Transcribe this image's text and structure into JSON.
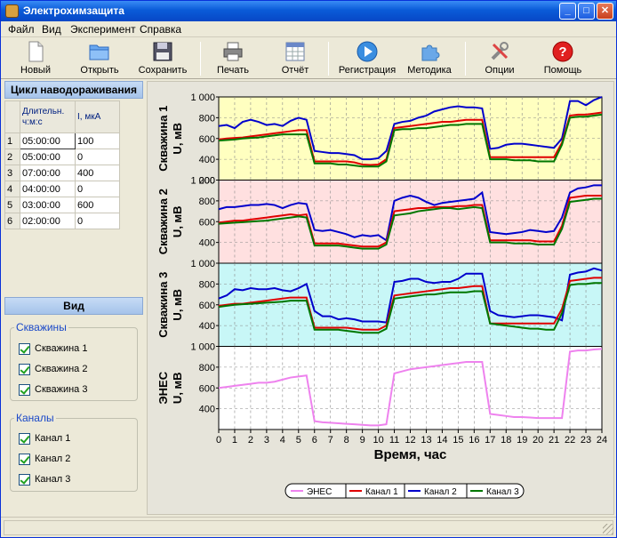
{
  "window": {
    "title": "Электрохимзащита"
  },
  "menu": [
    "Файл",
    "Вид",
    "Эксперимент",
    "Справка"
  ],
  "toolbar": [
    {
      "label": "Новый",
      "icon": "new-file-icon"
    },
    {
      "label": "Открыть",
      "icon": "folder-open-icon"
    },
    {
      "label": "Сохранить",
      "icon": "floppy-save-icon"
    },
    {
      "label": "Печать",
      "icon": "printer-icon"
    },
    {
      "label": "Отчёт",
      "icon": "report-table-icon"
    },
    {
      "label": "Регистрация",
      "icon": "play-record-icon"
    },
    {
      "label": "Методика",
      "icon": "puzzle-icon"
    },
    {
      "label": "Опции",
      "icon": "tools-icon"
    },
    {
      "label": "Помощь",
      "icon": "help-icon"
    }
  ],
  "cycle": {
    "title": "Цикл наводораживания",
    "col_duration": "Длительн. ч:м:с",
    "col_current": "I, мкА",
    "rows": [
      {
        "n": "1",
        "duration": "05:00:00",
        "current": "100"
      },
      {
        "n": "2",
        "duration": "05:00:00",
        "current": "0"
      },
      {
        "n": "3",
        "duration": "07:00:00",
        "current": "400"
      },
      {
        "n": "4",
        "duration": "04:00:00",
        "current": "0"
      },
      {
        "n": "5",
        "duration": "03:00:00",
        "current": "600"
      },
      {
        "n": "6",
        "duration": "02:00:00",
        "current": "0"
      }
    ]
  },
  "view": {
    "title": "Вид",
    "wells_group": "Скважины",
    "wells": [
      "Скважина 1",
      "Скважина 2",
      "Скважина 3"
    ],
    "channels_group": "Каналы",
    "channels": [
      "Канал 1",
      "Канал 2",
      "Канал 3"
    ]
  },
  "chart_data": {
    "type": "line",
    "xlabel": "Время, час",
    "x": [
      0,
      0.5,
      1,
      1.5,
      2,
      2.5,
      3,
      3.5,
      4,
      4.5,
      5,
      5.5,
      6,
      6.5,
      7,
      7.5,
      8,
      8.5,
      9,
      9.5,
      10,
      10.5,
      11,
      11.5,
      12,
      12.5,
      13,
      13.5,
      14,
      14.5,
      15,
      15.5,
      16,
      16.5,
      17,
      17.5,
      18,
      18.5,
      19,
      19.5,
      20,
      20.5,
      21,
      21.5,
      22,
      22.5,
      23,
      23.5,
      24
    ],
    "xticks": [
      0,
      1,
      2,
      3,
      4,
      5,
      6,
      7,
      8,
      9,
      10,
      11,
      12,
      13,
      14,
      15,
      16,
      17,
      18,
      19,
      20,
      21,
      22,
      23,
      24
    ],
    "ylim": [
      200,
      1000
    ],
    "yticks": [
      "200",
      "400",
      "600",
      "800",
      "1 000"
    ],
    "colors": {
      "ЭНЕС": "#ee82ee",
      "Канал 1": "#e00000",
      "Канал 2": "#0000cc",
      "Канал 3": "#007700"
    },
    "legend": [
      "ЭНЕС",
      "Канал 1",
      "Канал 2",
      "Канал 3"
    ],
    "panels": [
      {
        "ylabel1": "Скважина 1",
        "ylabel2": "U, мВ",
        "bg": "#ffffc0",
        "series": [
          {
            "name": "Канал 2",
            "values": [
              720,
              730,
              700,
              760,
              780,
              760,
              730,
              740,
              720,
              770,
              800,
              780,
              480,
              470,
              460,
              460,
              450,
              440,
              400,
              400,
              410,
              480,
              740,
              760,
              770,
              800,
              820,
              860,
              880,
              900,
              910,
              900,
              900,
              890,
              500,
              510,
              540,
              550,
              550,
              540,
              530,
              520,
              510,
              600,
              960,
              960,
              920,
              970,
              1000
            ]
          },
          {
            "name": "Канал 1",
            "values": [
              590,
              600,
              605,
              610,
              620,
              630,
              640,
              650,
              660,
              670,
              680,
              680,
              380,
              380,
              380,
              380,
              380,
              370,
              350,
              345,
              350,
              400,
              700,
              710,
              720,
              730,
              740,
              750,
              760,
              760,
              770,
              780,
              780,
              780,
              420,
              420,
              420,
              420,
              420,
              420,
              420,
              420,
              420,
              560,
              820,
              830,
              830,
              840,
              850
            ]
          },
          {
            "name": "Канал 3",
            "values": [
              580,
              585,
              590,
              600,
              605,
              610,
              620,
              630,
              640,
              640,
              640,
              640,
              360,
              360,
              360,
              350,
              350,
              340,
              330,
              330,
              330,
              380,
              680,
              690,
              690,
              700,
              700,
              710,
              720,
              730,
              730,
              740,
              740,
              740,
              400,
              400,
              400,
              390,
              390,
              390,
              380,
              380,
              380,
              540,
              800,
              810,
              810,
              820,
              830
            ]
          }
        ]
      },
      {
        "ylabel1": "Скважина 2",
        "ylabel2": "U, мВ",
        "bg": "#ffe0e0",
        "series": [
          {
            "name": "Канал 2",
            "values": [
              720,
              740,
              740,
              750,
              760,
              760,
              770,
              760,
              730,
              760,
              780,
              770,
              520,
              510,
              520,
              500,
              480,
              450,
              470,
              460,
              470,
              420,
              800,
              830,
              850,
              830,
              790,
              760,
              780,
              790,
              800,
              810,
              820,
              880,
              500,
              490,
              480,
              490,
              500,
              520,
              510,
              500,
              510,
              640,
              880,
              920,
              930,
              950,
              950
            ]
          },
          {
            "name": "Канал 1",
            "values": [
              590,
              600,
              610,
              610,
              620,
              630,
              640,
              650,
              660,
              670,
              660,
              670,
              390,
              390,
              390,
              390,
              380,
              370,
              360,
              360,
              360,
              400,
              700,
              710,
              720,
              730,
              730,
              740,
              740,
              740,
              750,
              750,
              760,
              760,
              420,
              420,
              420,
              420,
              420,
              420,
              410,
              410,
              410,
              560,
              830,
              840,
              850,
              850,
              850
            ]
          },
          {
            "name": "Канал 3",
            "values": [
              580,
              585,
              590,
              595,
              600,
              605,
              610,
              620,
              630,
              640,
              650,
              640,
              370,
              370,
              370,
              370,
              360,
              350,
              340,
              340,
              340,
              380,
              660,
              670,
              680,
              700,
              710,
              720,
              730,
              730,
              720,
              730,
              740,
              730,
              400,
              400,
              400,
              390,
              390,
              390,
              380,
              380,
              380,
              530,
              790,
              800,
              810,
              820,
              820
            ]
          }
        ]
      },
      {
        "ylabel1": "Скважина 3",
        "ylabel2": "U, мВ",
        "bg": "#c8f7f7",
        "series": [
          {
            "name": "Канал 2",
            "values": [
              660,
              690,
              750,
              740,
              760,
              750,
              750,
              760,
              740,
              730,
              760,
              800,
              540,
              490,
              490,
              460,
              470,
              460,
              440,
              440,
              440,
              430,
              820,
              830,
              850,
              850,
              820,
              810,
              820,
              820,
              850,
              900,
              900,
              900,
              540,
              500,
              490,
              480,
              490,
              500,
              500,
              490,
              480,
              450,
              890,
              910,
              920,
              950,
              930
            ]
          },
          {
            "name": "Канал 1",
            "values": [
              590,
              600,
              610,
              610,
              620,
              630,
              640,
              650,
              660,
              670,
              670,
              670,
              380,
              380,
              380,
              380,
              380,
              370,
              360,
              360,
              360,
              400,
              690,
              700,
              710,
              720,
              730,
              740,
              750,
              760,
              760,
              770,
              780,
              780,
              420,
              420,
              420,
              420,
              420,
              420,
              420,
              420,
              420,
              560,
              830,
              840,
              850,
              860,
              860
            ]
          },
          {
            "name": "Канал 3",
            "values": [
              580,
              590,
              600,
              605,
              610,
              615,
              620,
              625,
              630,
              640,
              640,
              640,
              360,
              360,
              360,
              360,
              350,
              340,
              330,
              330,
              330,
              370,
              660,
              670,
              680,
              690,
              700,
              700,
              710,
              720,
              720,
              720,
              730,
              730,
              420,
              410,
              400,
              390,
              380,
              370,
              370,
              360,
              360,
              520,
              790,
              800,
              800,
              810,
              810
            ]
          }
        ]
      },
      {
        "ylabel1": "ЭНЕС",
        "ylabel2": "U, мВ",
        "bg": "#ffffff",
        "series": [
          {
            "name": "ЭНЕС",
            "values": [
              600,
              610,
              620,
              630,
              640,
              650,
              650,
              660,
              680,
              700,
              710,
              720,
              280,
              270,
              265,
              260,
              255,
              250,
              245,
              240,
              240,
              250,
              740,
              760,
              780,
              790,
              800,
              810,
              820,
              830,
              840,
              850,
              850,
              850,
              350,
              340,
              330,
              320,
              320,
              315,
              310,
              310,
              310,
              310,
              950,
              960,
              960,
              970,
              975
            ]
          }
        ]
      }
    ]
  }
}
